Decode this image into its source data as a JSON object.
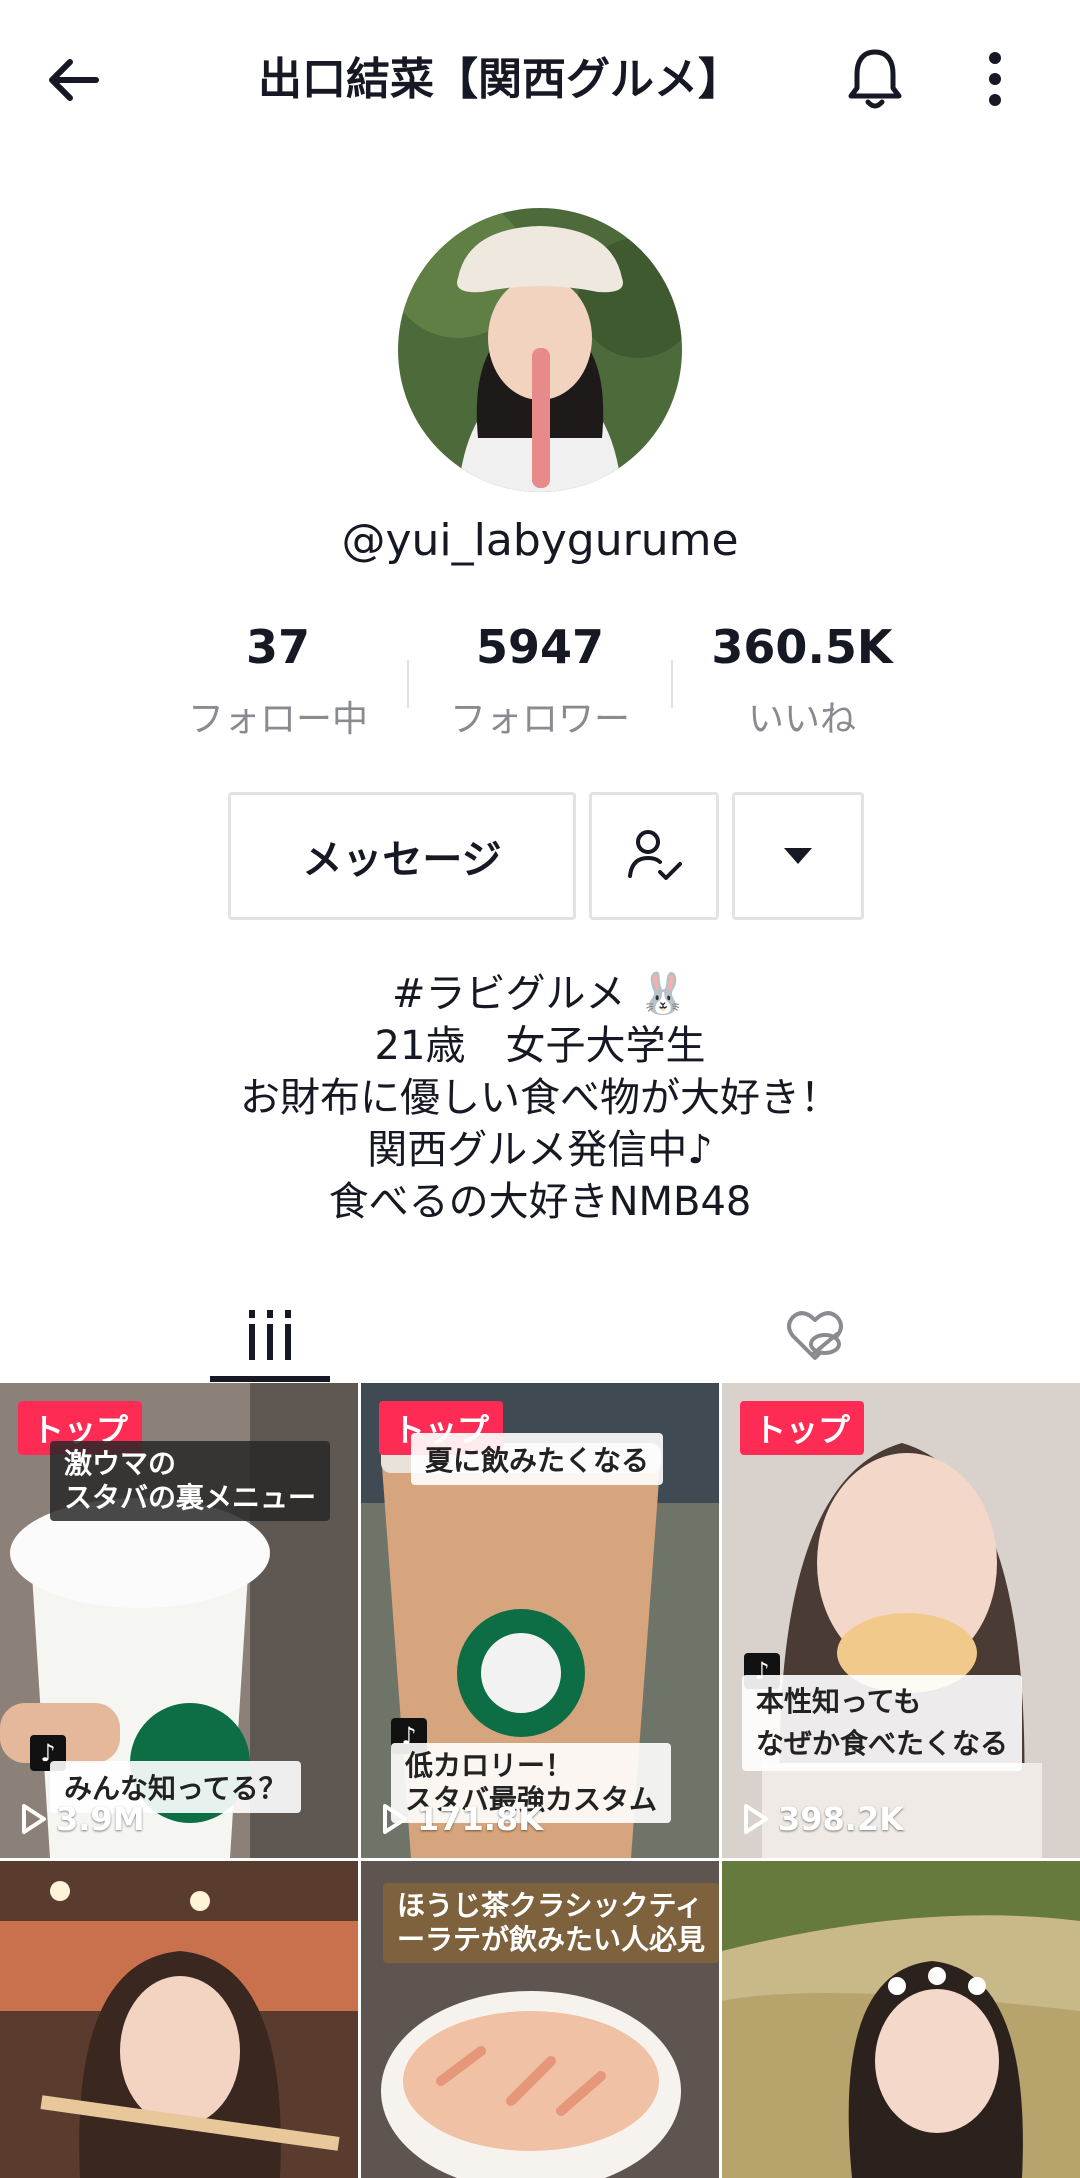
{
  "header": {
    "title": "出口結菜【関西グルメ】"
  },
  "profile": {
    "username": "@yui_labygurume",
    "stats": [
      {
        "value": "37",
        "label": "フォロー中"
      },
      {
        "value": "5947",
        "label": "フォロワー"
      },
      {
        "value": "360.5K",
        "label": "いいね"
      }
    ]
  },
  "actions": {
    "message_label": "メッセージ"
  },
  "bio": {
    "lines": [
      "#ラビグルメ 🐰",
      "21歳　女子大学生",
      "お財布に優しい食べ物が大好き！",
      "関西グルメ発信中♪",
      "食べるの大好きNMB48"
    ]
  },
  "videos": [
    {
      "badge": "トップ",
      "caption_top": "激ウマの\nスタバの裏メニュー",
      "caption_bottom": "みんな知ってる？",
      "views": "3.9M"
    },
    {
      "badge": "トップ",
      "caption_top": "夏に飲みたくなる",
      "caption_bottom": "低カロリー！\nスタバ最強カスタム",
      "views": "171.8K"
    },
    {
      "badge": "トップ",
      "caption_top": "",
      "caption_bottom": "本性知っても\nなぜか食べたくなる",
      "views": "398.2K"
    },
    {
      "badge": "",
      "caption_top": "",
      "caption_bottom": "",
      "views": ""
    },
    {
      "badge": "",
      "caption_top": "ほうじ茶クラシックティ\nーラテが飲みたい人必見",
      "caption_bottom": "",
      "views": ""
    },
    {
      "badge": "",
      "caption_top": "",
      "caption_bottom": "",
      "views": ""
    }
  ],
  "icons": {
    "back": "arrow-left-icon",
    "bell": "bell-icon",
    "more": "more-vertical-icon",
    "follow": "user-check-icon",
    "dropdown": "caret-down-icon",
    "videos_tab": "grid-bars-icon",
    "liked_tab": "heart-hidden-icon",
    "play": "play-icon"
  },
  "colors": {
    "accent": "#fe2c55",
    "text": "#161823",
    "muted": "#8a8b91"
  }
}
